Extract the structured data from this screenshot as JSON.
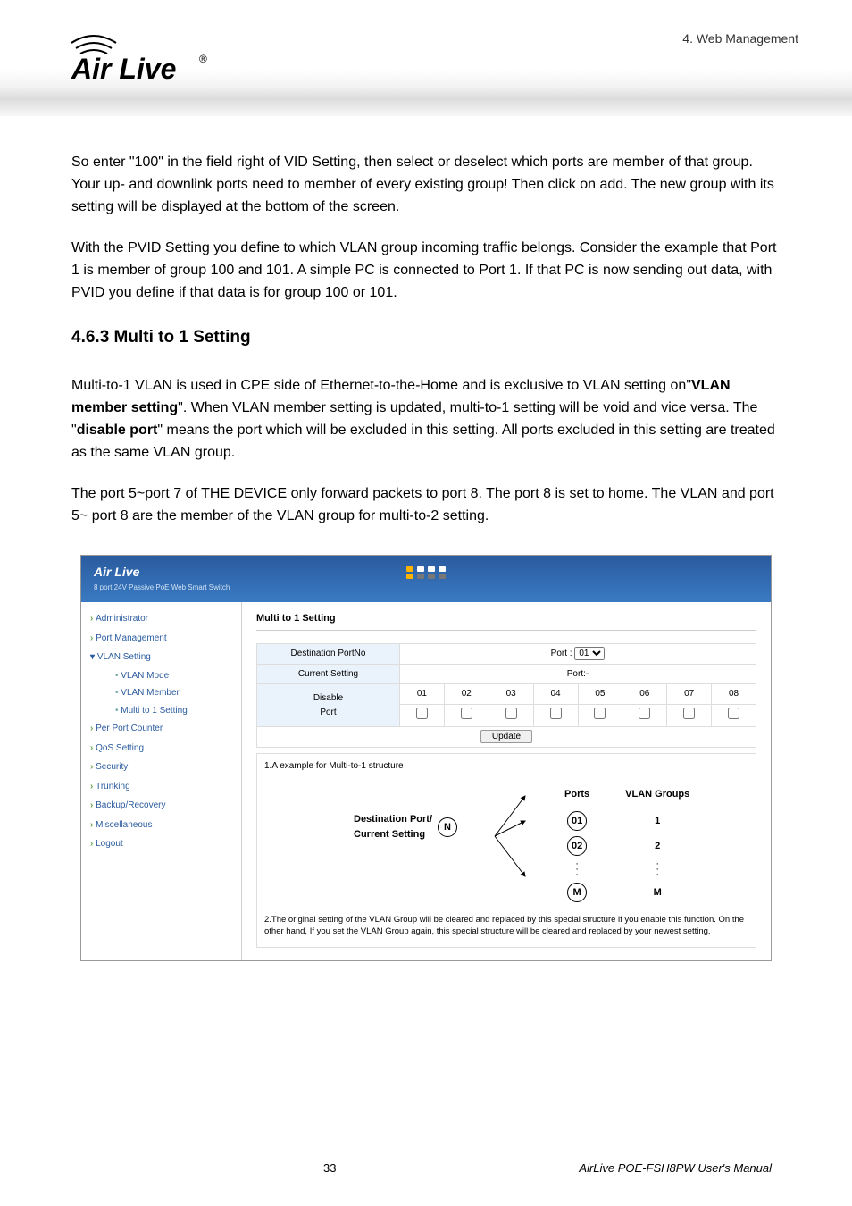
{
  "header": {
    "breadcrumb": "4.  Web Management",
    "logo_text": "Air Live",
    "logo_mark": "®"
  },
  "body": {
    "p1": "So enter \"100\" in the field right of VID Setting, then select or deselect which ports are member of that group. Your up- and downlink ports need to member of every existing group! Then click on add. The new group with its setting will be displayed at the bottom of the screen.",
    "p2": "With the PVID Setting you define to which VLAN group incoming traffic belongs. Consider the example that Port 1 is member of group 100 and 101. A simple PC is connected to Port 1. If that PC is now sending out data, with PVID you define if that data is for group 100 or 101.",
    "h2": "4.6.3 Multi to 1 Setting",
    "p3a": "Multi-to-1 VLAN is used in CPE side of Ethernet-to-the-Home and is exclusive to VLAN setting on\"",
    "p3b": "VLAN member setting",
    "p3c": "\". When VLAN member setting is updated, multi-to-1 setting will be void and vice versa. The \"",
    "p3d": "disable port",
    "p3e": "\" means the port which will be excluded in this setting. All ports excluded in this setting are treated as the same VLAN group.",
    "p4": "The port 5~port 7 of THE DEVICE only forward packets to port 8. The port 8 is set to home. The VLAN and port 5~ port 8 are the member of the VLAN group for multi-to-2 setting."
  },
  "screenshot": {
    "product_title": "Air Live",
    "product_subtitle": "8 port 24V Passive PoE Web Smart Switch",
    "nav": {
      "administrator": "Administrator",
      "port_management": "Port Management",
      "vlan_setting": "VLAN Setting",
      "vlan_mode": "VLAN Mode",
      "vlan_member": "VLAN Member",
      "multi_to_1": "Multi to 1 Setting",
      "per_port_counter": "Per Port Counter",
      "qos_setting": "QoS Setting",
      "security": "Security",
      "trunking": "Trunking",
      "backup_recovery": "Backup/Recovery",
      "miscellaneous": "Miscellaneous",
      "logout": "Logout"
    },
    "main": {
      "title": "Multi to 1 Setting",
      "dest_port_label": "Destination PortNo",
      "port_label": "Port :",
      "port_selected": "01",
      "current_setting_label": "Current Setting",
      "current_setting_value": "Port:-",
      "disable_port_label_1": "Disable",
      "disable_port_label_2": "Port",
      "ports": [
        "01",
        "02",
        "03",
        "04",
        "05",
        "06",
        "07",
        "08"
      ],
      "update_btn": "Update",
      "example_caption": "1.A example for Multi-to-1 structure",
      "diag_ports_head": "Ports",
      "diag_groups_head": "VLAN Groups",
      "diag_dest_label": "Destination Port/\nCurrent Setting",
      "diag_n": "N",
      "diag_01": "01",
      "diag_02": "02",
      "diag_m": "M",
      "diag_g1": "1",
      "diag_g2": "2",
      "diag_gm": "M",
      "note": "2.The original setting of the VLAN Group will be cleared and replaced by this special structure if you enable this function. On the other hand, If you set the VLAN Group again, this special structure will be cleared and replaced by your newest setting."
    }
  },
  "footer": {
    "page_no": "33",
    "manual": "AirLive POE-FSH8PW User's Manual"
  }
}
